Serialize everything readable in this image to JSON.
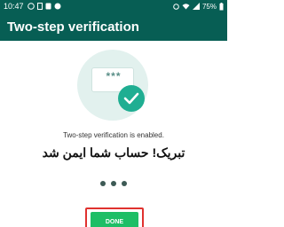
{
  "status_bar": {
    "time": "10:47",
    "battery": "75%"
  },
  "app_bar": {
    "title": "Two-step verification"
  },
  "illustration": {
    "password_mask": "***"
  },
  "main": {
    "status_message": "Two-step verification is enabled.",
    "persian_message": "تبریک! حساب شما ایمن شد",
    "page_count": 3
  },
  "footer": {
    "done_label": "DONE"
  },
  "colors": {
    "header": "#075e54",
    "accent": "#1fae92",
    "button": "#1ebe66",
    "highlight_border": "#e0322f"
  }
}
